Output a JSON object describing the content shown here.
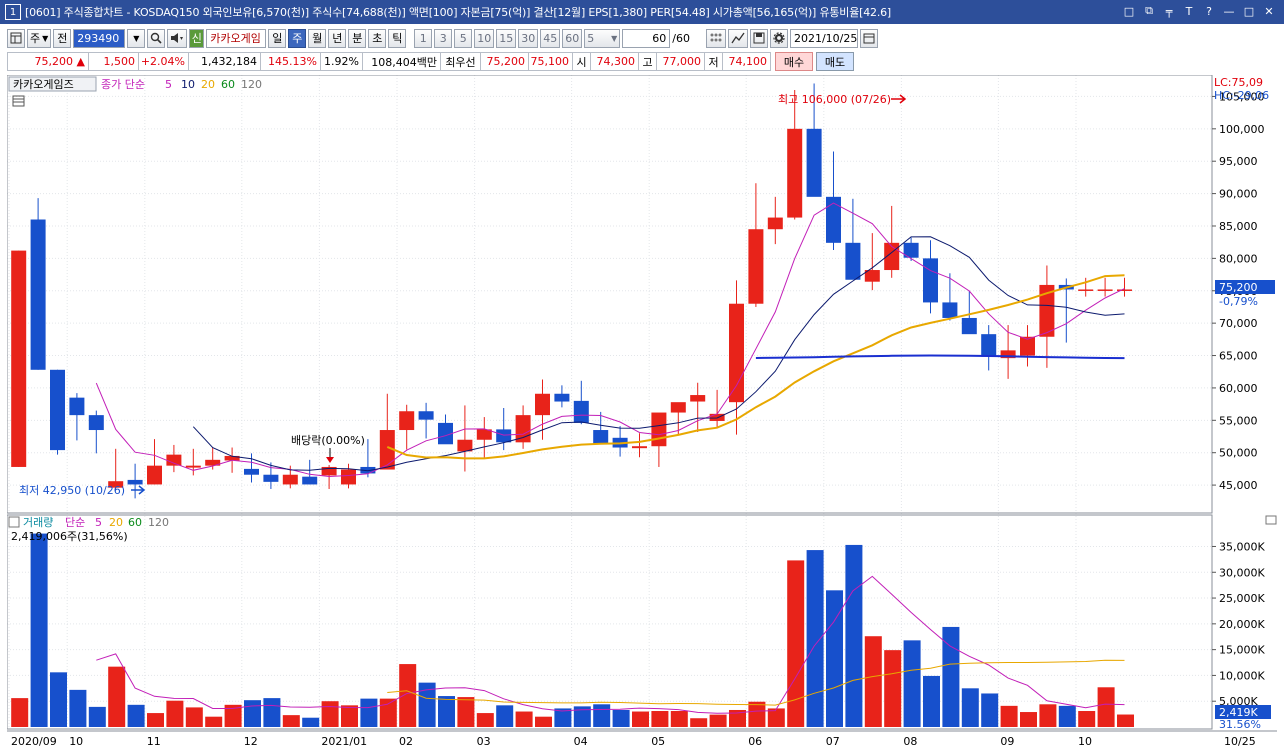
{
  "titlebar": {
    "window_no": "1",
    "title": "[0601] 주식종합차트 - KOSDAQ150 외국인보유[6,570(천)] 주식수[74,688(천)] 액면[100] 자본금[75(억)] 결산[12월] EPS[1,380] PER[54.48] 시가총액[56,165(억)] 유통비율[42.6]",
    "controls": [
      "□",
      "⧉",
      "╤",
      "T",
      "?",
      "—",
      "□",
      "✕"
    ]
  },
  "toolbar": {
    "cycle": "주",
    "prev_btn": "전",
    "code": "293490",
    "name": "카카오게임",
    "periods": [
      "일",
      "주",
      "월",
      "년",
      "분",
      "초",
      "틱"
    ],
    "active_period": "주",
    "counts": [
      "1",
      "3",
      "5",
      "10",
      "15",
      "30",
      "45",
      "60"
    ],
    "count_select": "5",
    "view_count": "60",
    "view_total": "/60",
    "date": "2021/10/25"
  },
  "info": {
    "price": "75,200",
    "arrow": "▲",
    "change": "1,500",
    "change_pct": "+2.04%",
    "volume": "1,432,184",
    "vol_ratio": "145.13%",
    "turnover": "1.92%",
    "amount": "108,404백만",
    "best_label": "최우선",
    "best_ask": "75,200",
    "best_bid": "75,100",
    "open_label": "시",
    "open": "74,300",
    "high_label": "고",
    "high": "77,000",
    "low_label": "저",
    "low": "74,100",
    "buy": "매수",
    "sell": "매도"
  },
  "price_panel": {
    "legend_name": "카카오게임즈",
    "legend_ma": "종가 단순",
    "ma_periods": [
      "5",
      "10",
      "20",
      "60",
      "120"
    ],
    "lc_label": "LC:75,09",
    "hc_label": "HC:-29,06",
    "current_price_label": "75,200",
    "current_pct_label": "-0,79%",
    "high_note": "최고 106,000 (07/26)",
    "low_note": "최저 42,950 (10/26)",
    "dividend_note": "배당락(0.00%)",
    "y_labels": [
      "105,000",
      "100,000",
      "95,000",
      "90,000",
      "85,000",
      "80,000",
      "75,000",
      "70,000",
      "65,000",
      "60,000",
      "55,000",
      "50,000",
      "45,000"
    ]
  },
  "volume_panel": {
    "legend_name": "거래량",
    "legend_ma": "단순",
    "ma_periods": [
      "5",
      "20",
      "60",
      "120"
    ],
    "summary": "2,419,006주(31,56%)",
    "current_label": "2,419K",
    "current_pct": "31.56%",
    "y_labels": [
      "35,000K",
      "30,000K",
      "25,000K",
      "20,000K",
      "15,000K",
      "10,000K",
      "5,000K"
    ]
  },
  "x_labels": [
    "2020/09",
    "10",
    "11",
    "12",
    "2021/01",
    "02",
    "03",
    "04",
    "05",
    "06",
    "07",
    "08",
    "09",
    "10",
    "10/25"
  ],
  "colors": {
    "up": "#e8231a",
    "down": "#1750cc",
    "ma5": "#c21fb8",
    "ma10": "#0c1a6e",
    "ma20": "#e8a800",
    "ma60": "#1a2fd0",
    "vol_ma5": "#c21fb8",
    "vol_ma20": "#e8a800"
  },
  "chart_data": {
    "type": "candlestick",
    "x": [
      "2020-09-14",
      "2020-09-21",
      "2020-09-28",
      "2020-10-05",
      "2020-10-12",
      "2020-10-19",
      "2020-10-26",
      "2020-11-02",
      "2020-11-09",
      "2020-11-16",
      "2020-11-23",
      "2020-11-30",
      "2020-12-07",
      "2020-12-14",
      "2020-12-21",
      "2020-12-28",
      "2021-01-04",
      "2021-01-11",
      "2021-01-18",
      "2021-01-25",
      "2021-02-01",
      "2021-02-08",
      "2021-02-15",
      "2021-02-22",
      "2021-03-01",
      "2021-03-08",
      "2021-03-15",
      "2021-03-22",
      "2021-03-29",
      "2021-04-05",
      "2021-04-12",
      "2021-04-19",
      "2021-04-26",
      "2021-05-03",
      "2021-05-10",
      "2021-05-17",
      "2021-05-24",
      "2021-05-31",
      "2021-06-07",
      "2021-06-14",
      "2021-06-21",
      "2021-06-28",
      "2021-07-05",
      "2021-07-12",
      "2021-07-19",
      "2021-07-26",
      "2021-08-02",
      "2021-08-09",
      "2021-08-16",
      "2021-08-23",
      "2021-08-30",
      "2021-09-06",
      "2021-09-13",
      "2021-09-20",
      "2021-09-27",
      "2021-10-04",
      "2021-10-11",
      "2021-10-18",
      "2021-10-25"
    ],
    "open": [
      47800,
      86000,
      62800,
      58500,
      55800,
      44600,
      45800,
      45100,
      48000,
      47700,
      48000,
      48800,
      47500,
      46600,
      45100,
      46300,
      46500,
      45100,
      47800,
      47400,
      53500,
      56400,
      54600,
      50200,
      52000,
      53600,
      51600,
      55800,
      59100,
      58000,
      53500,
      52300,
      50700,
      51000,
      56200,
      57900,
      54900,
      57800,
      73000,
      84500,
      86300,
      100000,
      89500,
      82400,
      76400,
      78200,
      82400,
      80000,
      73200,
      70800,
      68300,
      64600,
      65000,
      67900,
      75900,
      75200,
      75200,
      75200,
      75200
    ],
    "high": [
      81200,
      89300,
      62800,
      59200,
      56500,
      50600,
      48300,
      52100,
      51200,
      50600,
      50800,
      50800,
      49900,
      48500,
      48000,
      48900,
      48100,
      48300,
      52100,
      59100,
      57400,
      57700,
      55900,
      57300,
      55500,
      56900,
      57300,
      61300,
      60400,
      61100,
      56300,
      54100,
      53000,
      51800,
      56800,
      60800,
      59700,
      76600,
      91600,
      89500,
      106000,
      107000,
      96500,
      89200,
      83900,
      88100,
      83200,
      82800,
      77700,
      75000,
      69700,
      69700,
      69700,
      78900,
      76900,
      77000,
      77000,
      77000,
      77000
    ],
    "low": [
      47800,
      62800,
      49700,
      51900,
      49900,
      44300,
      42950,
      45100,
      47000,
      46500,
      47400,
      46900,
      45400,
      44400,
      44500,
      45100,
      44400,
      44500,
      46200,
      47600,
      50500,
      52200,
      52500,
      47100,
      49100,
      50400,
      50600,
      52000,
      57000,
      54400,
      51300,
      49400,
      49300,
      47800,
      52700,
      53200,
      53900,
      52800,
      72500,
      82200,
      86000,
      98000,
      81300,
      81700,
      75100,
      77000,
      79600,
      71500,
      70400,
      69700,
      62700,
      61400,
      63300,
      63100,
      67000,
      74100,
      74100,
      74100,
      74100
    ],
    "close": [
      81200,
      62800,
      50400,
      55800,
      53500,
      45600,
      45100,
      48000,
      49700,
      48000,
      48900,
      49500,
      46600,
      45500,
      46600,
      45100,
      47800,
      47400,
      46800,
      53500,
      56400,
      55100,
      51300,
      52000,
      53600,
      51600,
      55800,
      59100,
      57900,
      54600,
      51300,
      50800,
      51000,
      56200,
      57800,
      58900,
      56000,
      73000,
      84500,
      86300,
      100000,
      89500,
      82400,
      76700,
      78200,
      82400,
      80100,
      73200,
      70800,
      68300,
      64800,
      65800,
      67900,
      75900,
      75200,
      75200,
      75200,
      75200,
      75200
    ],
    "volume": [
      5600,
      37500,
      10600,
      7200,
      3900,
      11700,
      4300,
      2700,
      5100,
      3800,
      2000,
      4300,
      5200,
      5600,
      2300,
      1800,
      5000,
      4200,
      5500,
      5500,
      12200,
      8600,
      6000,
      5800,
      2700,
      4200,
      3000,
      2000,
      3600,
      4000,
      4400,
      3300,
      3000,
      3100,
      3100,
      1700,
      2400,
      3300,
      4900,
      3600,
      32300,
      34300,
      26500,
      35300,
      17600,
      14900,
      16800,
      9900,
      19400,
      7500,
      6500,
      4100,
      2900,
      4400,
      4100,
      3100,
      7700,
      2419,
      2419
    ]
  }
}
